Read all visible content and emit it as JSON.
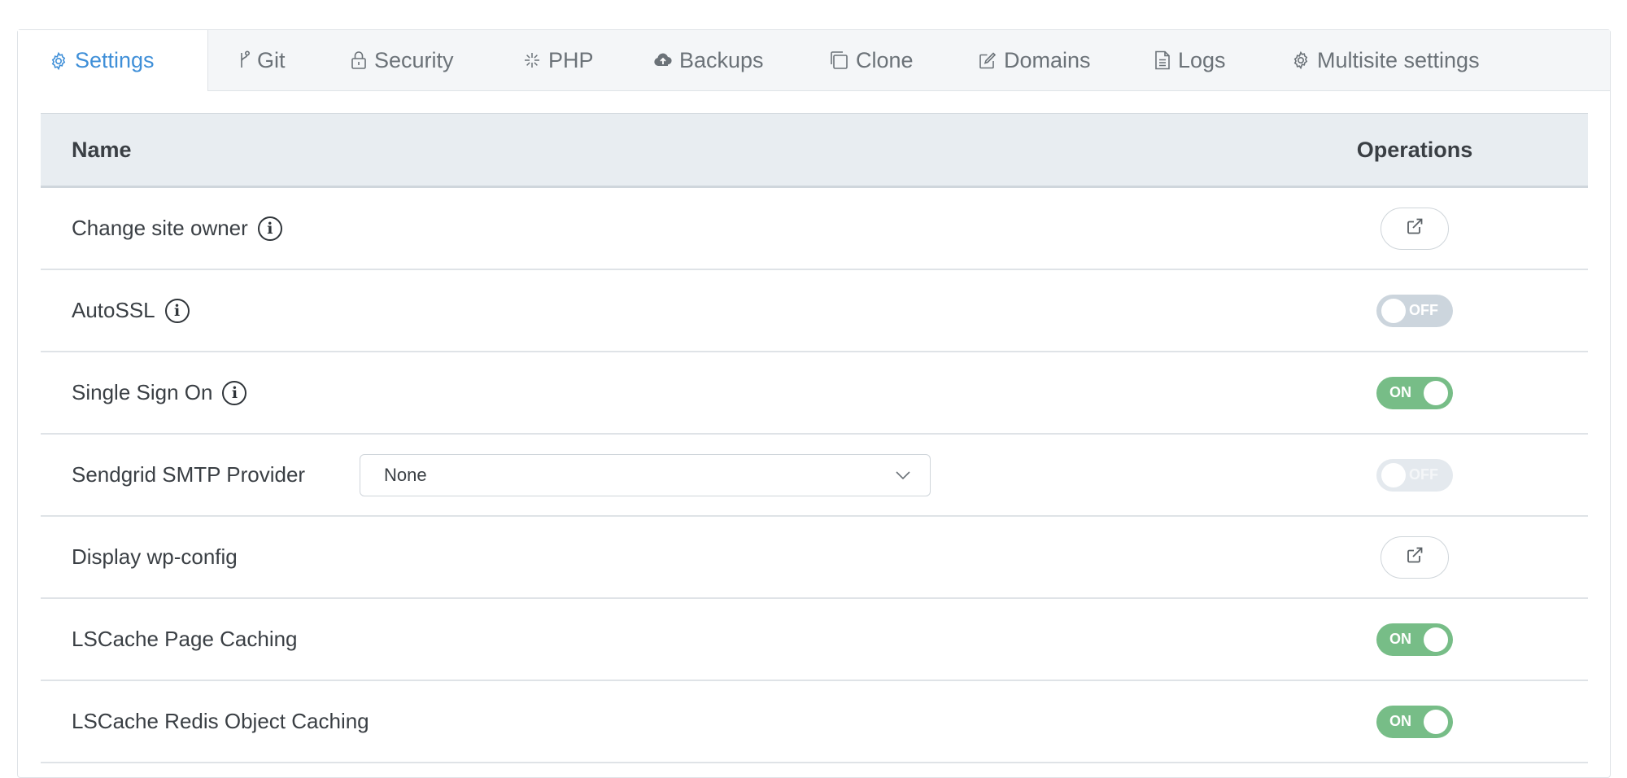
{
  "tabs": [
    {
      "label": "Settings",
      "icon": "gear-icon",
      "active": true
    },
    {
      "label": "Git",
      "icon": "git-branch-icon"
    },
    {
      "label": "Security",
      "icon": "lock-icon"
    },
    {
      "label": "PHP",
      "icon": "sparkle-icon"
    },
    {
      "label": "Backups",
      "icon": "cloud-upload-icon"
    },
    {
      "label": "Clone",
      "icon": "copy-icon"
    },
    {
      "label": "Domains",
      "icon": "edit-icon"
    },
    {
      "label": "Logs",
      "icon": "document-icon"
    },
    {
      "label": "Multisite settings",
      "icon": "gear-icon"
    }
  ],
  "table": {
    "headers": {
      "name": "Name",
      "operations": "Operations"
    },
    "rows": [
      {
        "label": "Change site owner",
        "info": true,
        "operation": "external-link"
      },
      {
        "label": "AutoSSL",
        "info": true,
        "operation": "toggle",
        "state": "OFF"
      },
      {
        "label": "Single Sign On",
        "info": true,
        "operation": "toggle",
        "state": "ON"
      },
      {
        "label": "Sendgrid SMTP Provider",
        "info": false,
        "operation": "toggle",
        "state": "OFF",
        "disabled": true,
        "select_value": "None"
      },
      {
        "label": "Display wp-config",
        "info": false,
        "operation": "external-link"
      },
      {
        "label": "LSCache Page Caching",
        "info": false,
        "operation": "toggle",
        "state": "ON"
      },
      {
        "label": "LSCache Redis Object Caching",
        "info": false,
        "operation": "toggle",
        "state": "ON"
      }
    ]
  },
  "colors": {
    "accent": "#3f8fd8",
    "toggle_on": "#77bd87",
    "toggle_off": "#ccd5dd",
    "header_bg": "#e8edf1"
  }
}
